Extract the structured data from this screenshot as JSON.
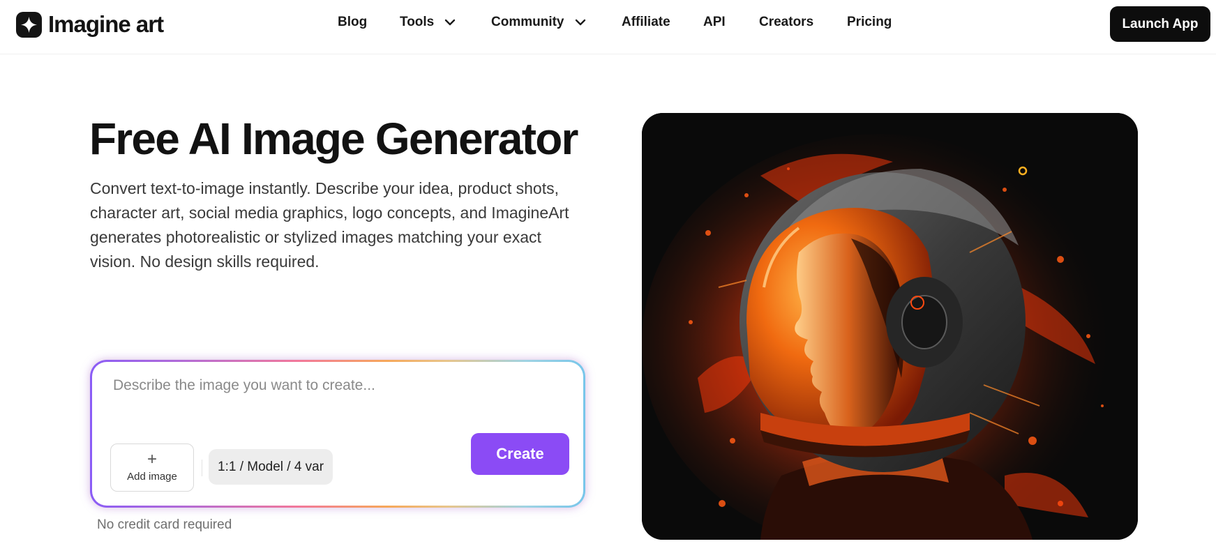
{
  "brand": {
    "name": "Imagine art",
    "logo_icon": "sparkle-logo-icon"
  },
  "nav": {
    "items": [
      {
        "label": "Blog",
        "dropdown": false
      },
      {
        "label": "Tools",
        "dropdown": true
      },
      {
        "label": "Community",
        "dropdown": true
      },
      {
        "label": "Affiliate",
        "dropdown": false
      },
      {
        "label": "API",
        "dropdown": false
      },
      {
        "label": "Creators",
        "dropdown": false
      },
      {
        "label": "Pricing",
        "dropdown": false
      }
    ],
    "cta": "Launch App"
  },
  "hero": {
    "title": "Free AI Image Generator",
    "description": "Convert text-to-image instantly. Describe your idea, product shots, character art, social media graphics, logo concepts, and ImagineArt generates photorealistic or stylized images matching your exact vision. No design skills required."
  },
  "prompt": {
    "placeholder": "Describe the image you want to create...",
    "value": "",
    "add_image_label": "Add image",
    "settings_label": "1:1 / Model / 4 var",
    "create_label": "Create",
    "note": "No credit card required"
  },
  "colors": {
    "accent": "#8b4bf5",
    "dark": "#0d0d0d",
    "border_gradient": [
      "#8a5cf6",
      "#f2789a",
      "#f6a85a",
      "#78c6ea"
    ]
  }
}
